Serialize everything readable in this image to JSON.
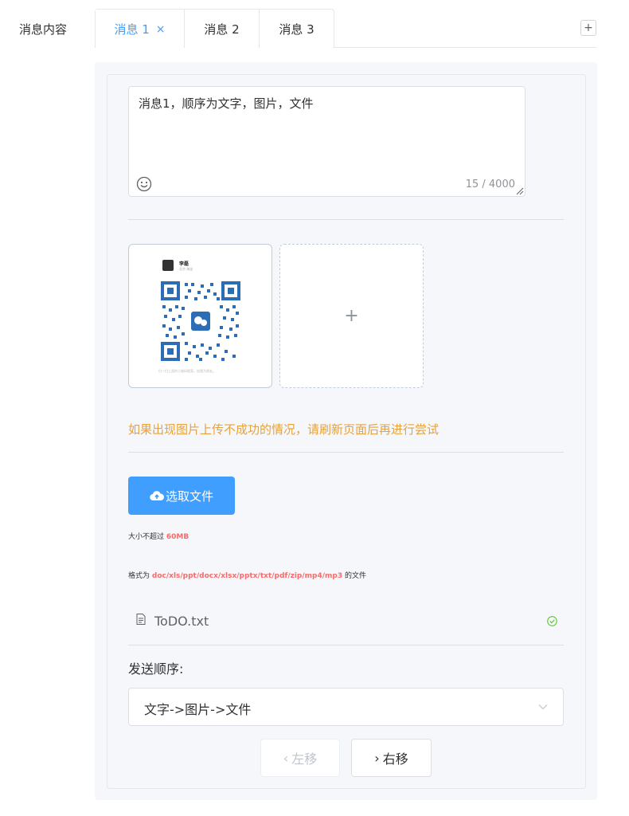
{
  "form": {
    "label": "消息内容"
  },
  "tabs": [
    {
      "label": "消息 1",
      "active": true,
      "close": "×"
    },
    {
      "label": "消息 2",
      "active": false
    },
    {
      "label": "消息 3",
      "active": false
    }
  ],
  "add_tab": "+",
  "message": {
    "text": "消息1，顺序为文字，图片，文件",
    "count": "15 / 4000"
  },
  "image_upload": {
    "add_symbol": "+",
    "qr_card": {
      "name": "李磊",
      "sub": "北京 海淀",
      "caption": "扫一扫上面的二维码图案，加我为朋友。"
    }
  },
  "upload_warning": "如果出现图片上传不成功的情况，请刷新页面后再进行尝试",
  "file_upload": {
    "button_label": "选取文件",
    "size_tip_prefix": "大小不超过",
    "size_limit": "60MB",
    "format_tip_prefix": "格式为",
    "formats": "doc/xls/ppt/docx/xlsx/pptx/txt/pdf/zip/mp4/mp3",
    "format_tip_suffix": "的文件",
    "files": [
      {
        "name": "ToDO.txt",
        "status": "success"
      }
    ]
  },
  "send_order": {
    "label": "发送顺序:",
    "value": "文字->图片->文件"
  },
  "move_buttons": {
    "left": "左移",
    "right": "右移"
  },
  "colors": {
    "primary": "#409eff",
    "warning": "#e6a23c",
    "danger": "#f56c6c",
    "success": "#67c23a"
  }
}
